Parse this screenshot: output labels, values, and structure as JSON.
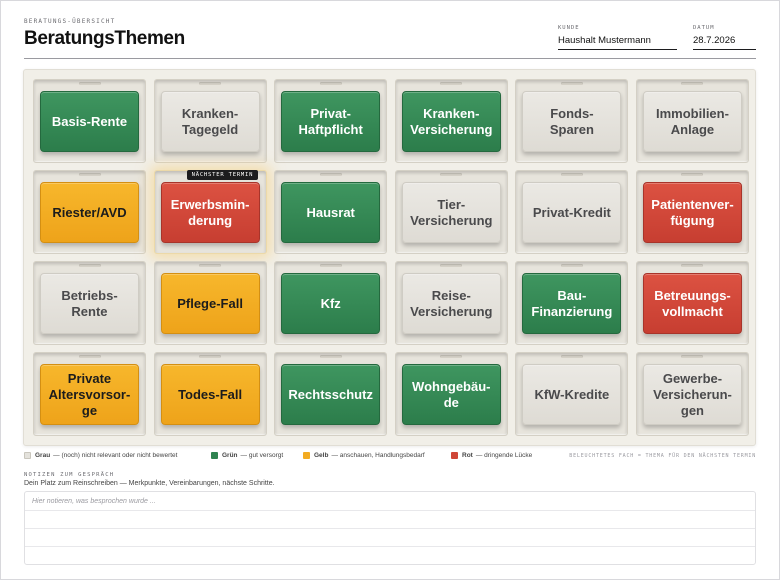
{
  "header": {
    "eyebrow": "BERATUNGS-ÜBERSICHT",
    "title": "BeratungsThemen",
    "kunde_label": "KUNDE",
    "kunde_value": "Haushalt Mustermann",
    "datum_label": "DATUM",
    "datum_value": "28.7.2026"
  },
  "colors": {
    "grau": "#e4e2dc",
    "gruen": "#2f8350",
    "gelb": "#f2ab22",
    "rot": "#cf4637"
  },
  "board": {
    "highlight_badge": "NÄCHSTER TERMIN",
    "highlight_index": 7,
    "tiles": [
      {
        "label": "Basis-Rente",
        "status": "gruen"
      },
      {
        "label": "Kranken-\nTagegeld",
        "status": "grau"
      },
      {
        "label": "Privat-\nHaftpflicht",
        "status": "gruen"
      },
      {
        "label": "Kranken-\nVersicherung",
        "status": "gruen"
      },
      {
        "label": "Fonds-Sparen",
        "status": "grau"
      },
      {
        "label": "Immobilien-\nAnlage",
        "status": "grau"
      },
      {
        "label": "Riester/AVD",
        "status": "gelb"
      },
      {
        "label": "Erwerbsmin-\nderung",
        "status": "rot"
      },
      {
        "label": "Hausrat",
        "status": "gruen"
      },
      {
        "label": "Tier-\nVersicherung",
        "status": "grau"
      },
      {
        "label": "Privat-Kredit",
        "status": "grau"
      },
      {
        "label": "Patientenver-\nfügung",
        "status": "rot"
      },
      {
        "label": "Betriebs-\nRente",
        "status": "grau"
      },
      {
        "label": "Pflege-Fall",
        "status": "gelb"
      },
      {
        "label": "Kfz",
        "status": "gruen"
      },
      {
        "label": "Reise-\nVersicherung",
        "status": "grau"
      },
      {
        "label": "Bau-\nFinanzierung",
        "status": "gruen"
      },
      {
        "label": "Betreuungs-\nvollmacht",
        "status": "rot"
      },
      {
        "label": "Private\nAltersvorsor-\nge",
        "status": "gelb"
      },
      {
        "label": "Todes-Fall",
        "status": "gelb"
      },
      {
        "label": "Rechtsschutz",
        "status": "gruen"
      },
      {
        "label": "Wohngebäu-\nde",
        "status": "gruen"
      },
      {
        "label": "KfW-Kredite",
        "status": "grau"
      },
      {
        "label": "Gewerbe-\nVersicherun-\ngen",
        "status": "grau"
      }
    ]
  },
  "legend": {
    "items": [
      {
        "key": "grau",
        "name": "Grau",
        "text": "— (noch) nicht relevant oder nicht bewertet"
      },
      {
        "key": "gruen",
        "name": "Grün",
        "text": "— gut versorgt"
      },
      {
        "key": "gelb",
        "name": "Gelb",
        "text": "— anschauen, Handlungsbedarf"
      },
      {
        "key": "rot",
        "name": "Rot",
        "text": "— dringende Lücke"
      }
    ],
    "hint": "BELEUCHTETES FACH = THEMA FÜR DEN NÄCHSTEN TERMIN"
  },
  "notes": {
    "heading": "NOTIZEN ZUM GESPRÄCH",
    "subtitle": "Dein Platz zum Reinschreiben — Merkpunkte, Vereinbarungen, nächste Schritte.",
    "placeholder": "Hier notieren, was besprochen wurde ..."
  }
}
